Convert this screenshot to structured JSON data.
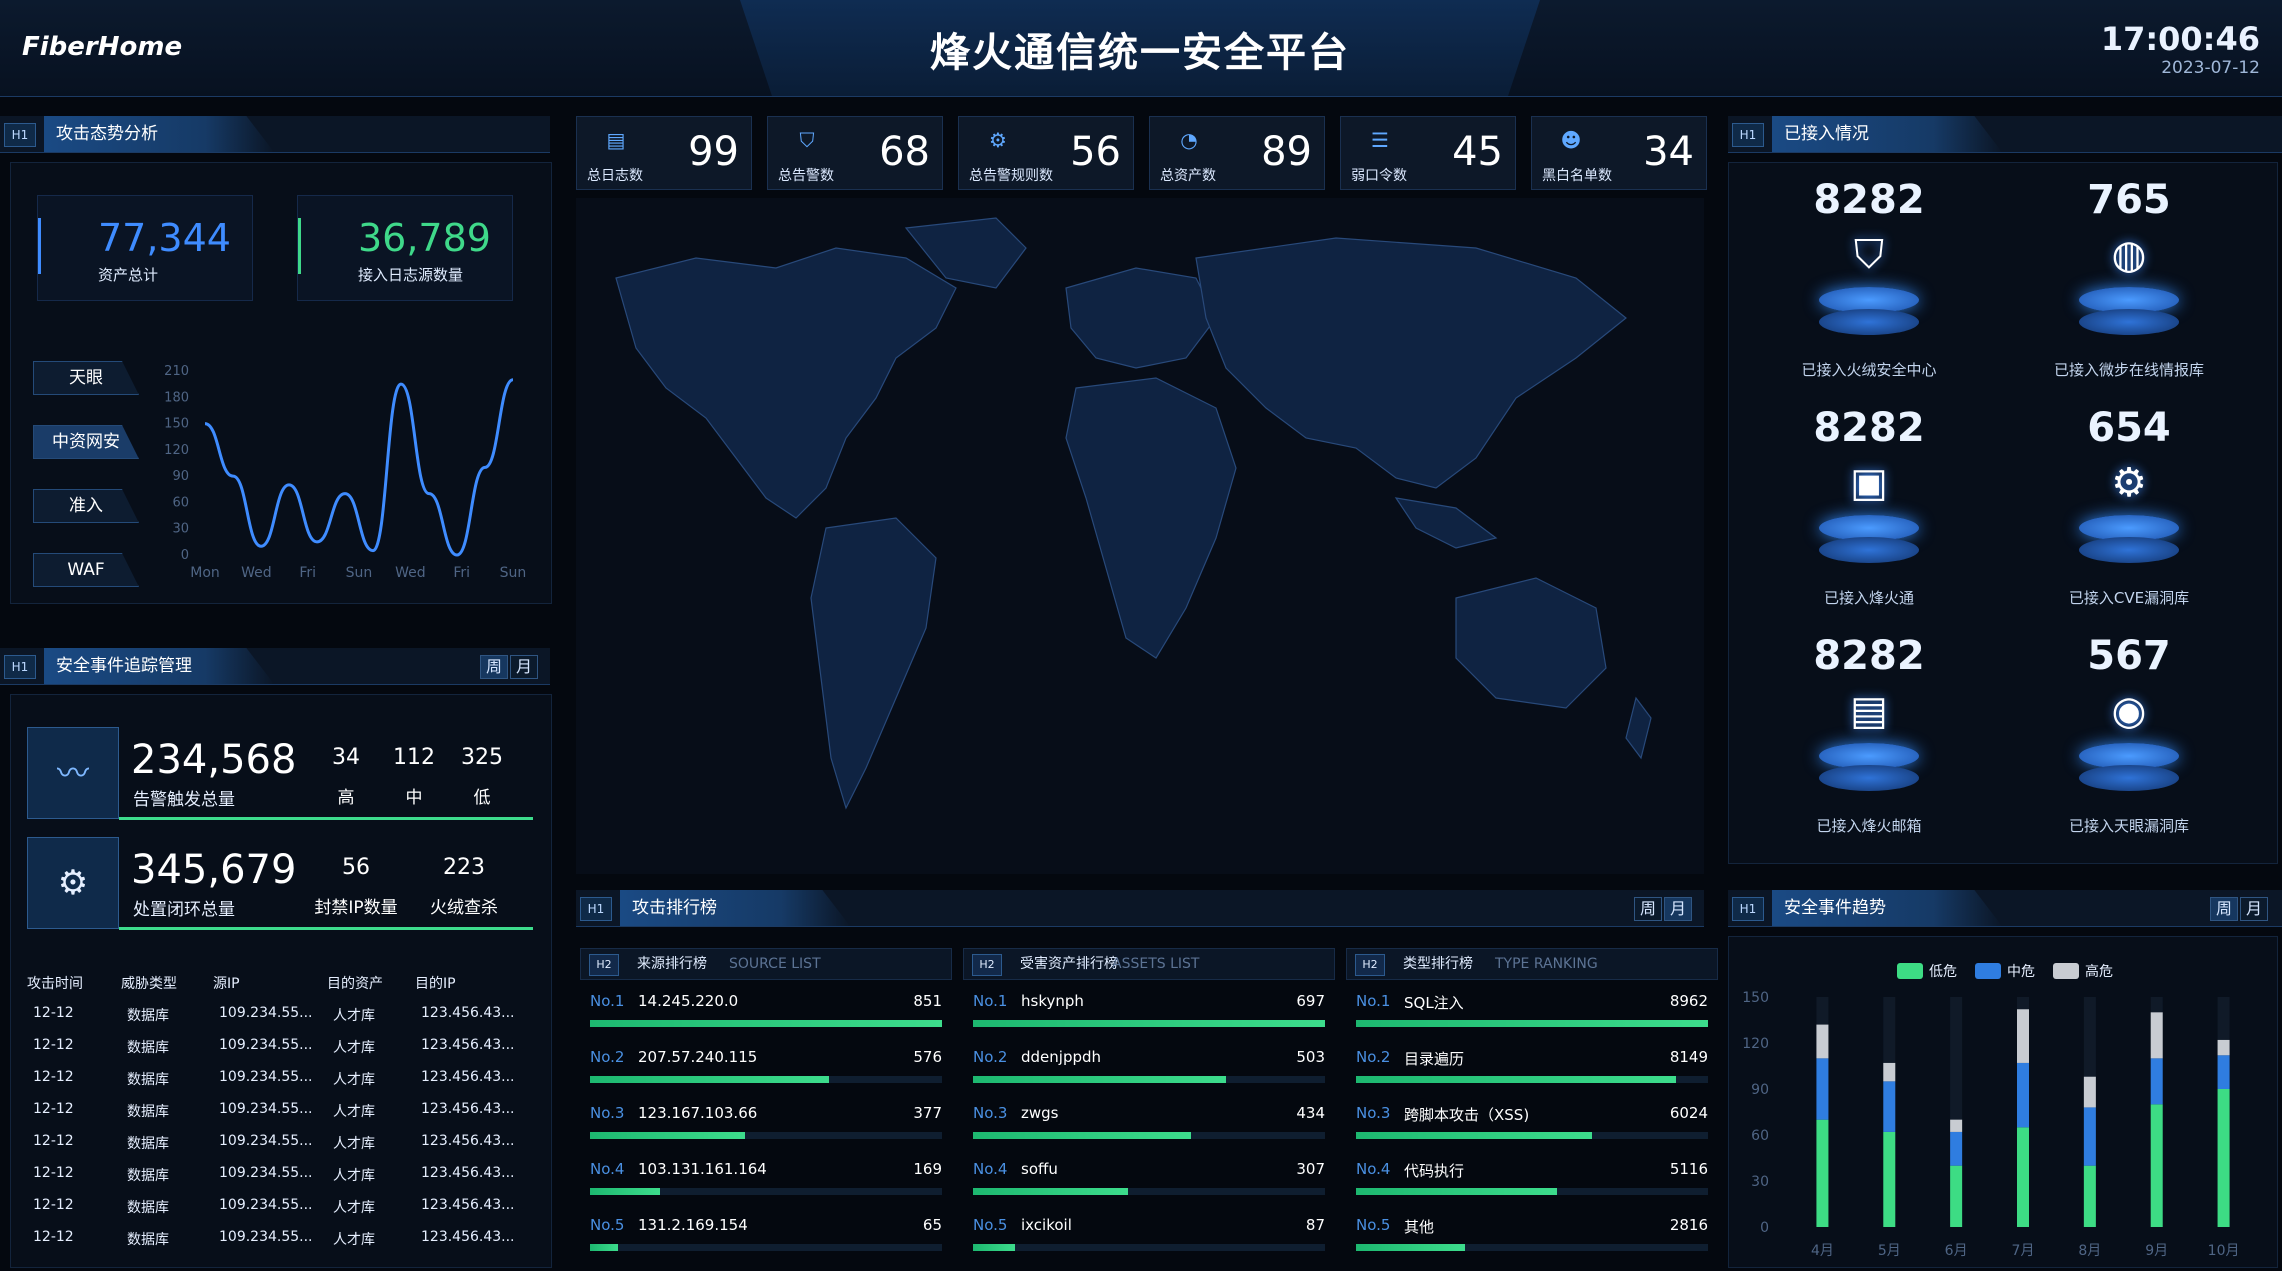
{
  "header": {
    "logo": "FiberHome",
    "title": "烽火通信统一安全平台",
    "time": "17:00:46",
    "date": "2023-07-12"
  },
  "attack_panel": {
    "tag": "H1",
    "title": "攻击态势分析",
    "kpi1": {
      "value": "77,344",
      "label": "资产总计",
      "color": "#3f8cff"
    },
    "kpi2": {
      "value": "36,789",
      "label": "接入日志源数量",
      "color": "#3fd98a"
    },
    "tabs": [
      "天眼",
      "中资网安",
      "准入",
      "WAF"
    ],
    "chart_data": {
      "type": "line",
      "x": [
        "Mon",
        "Wed",
        "Fri",
        "Sun",
        "Wed",
        "Fri",
        "Sun"
      ],
      "y_ticks": [
        "210",
        "180",
        "150",
        "120",
        "90",
        "60",
        "30",
        "0"
      ],
      "ylim": [
        0,
        210
      ],
      "values": [
        150,
        90,
        10,
        80,
        15,
        70,
        5,
        195,
        70,
        0,
        100,
        200
      ]
    }
  },
  "stats": [
    {
      "icon": "log-icon",
      "label": "总日志数",
      "value": "99"
    },
    {
      "icon": "shield-icon",
      "label": "总告警数",
      "value": "68"
    },
    {
      "icon": "rules-icon",
      "label": "总告警规则数",
      "value": "56"
    },
    {
      "icon": "pie-icon",
      "label": "总资产数",
      "value": "89"
    },
    {
      "icon": "password-icon",
      "label": "弱口令数",
      "value": "45"
    },
    {
      "icon": "user-icon",
      "label": "黑白名单数",
      "value": "34"
    }
  ],
  "connected": {
    "tag": "H1",
    "title": "已接入情况",
    "items": [
      {
        "value": "8282",
        "label": "已接入火绒安全中心",
        "icon": "shield-icon"
      },
      {
        "value": "765",
        "label": "已接入微步在线情报库",
        "icon": "globe-icon"
      },
      {
        "value": "8282",
        "label": "已接入烽火通",
        "icon": "cube-icon"
      },
      {
        "value": "654",
        "label": "已接入CVE漏洞库",
        "icon": "gear-icon"
      },
      {
        "value": "8282",
        "label": "已接入烽火邮箱",
        "icon": "mail-icon"
      },
      {
        "value": "567",
        "label": "已接入天眼漏洞库",
        "icon": "eye-icon"
      }
    ]
  },
  "events": {
    "tag": "H1",
    "title": "安全事件追踪管理",
    "week": "周",
    "month": "月",
    "alert_total": "234,568",
    "alert_label": "告警触发总量",
    "alert_breakdown": [
      {
        "v": "34",
        "l": "高"
      },
      {
        "v": "112",
        "l": "中"
      },
      {
        "v": "325",
        "l": "低"
      }
    ],
    "handled_total": "345,679",
    "handled_label": "处置闭环总量",
    "handled_breakdown": [
      {
        "v": "56",
        "l": "封禁IP数量"
      },
      {
        "v": "223",
        "l": "火绒查杀"
      }
    ],
    "columns": [
      "攻击时间",
      "威胁类型",
      "源IP",
      "目的资产",
      "目的IP"
    ],
    "rows": [
      [
        "12-12",
        "数据库",
        "109.234.55...",
        "人才库",
        "123.456.43..."
      ],
      [
        "12-12",
        "数据库",
        "109.234.55...",
        "人才库",
        "123.456.43..."
      ],
      [
        "12-12",
        "数据库",
        "109.234.55...",
        "人才库",
        "123.456.43..."
      ],
      [
        "12-12",
        "数据库",
        "109.234.55...",
        "人才库",
        "123.456.43..."
      ],
      [
        "12-12",
        "数据库",
        "109.234.55...",
        "人才库",
        "123.456.43..."
      ],
      [
        "12-12",
        "数据库",
        "109.234.55...",
        "人才库",
        "123.456.43..."
      ],
      [
        "12-12",
        "数据库",
        "109.234.55...",
        "人才库",
        "123.456.43..."
      ],
      [
        "12-12",
        "数据库",
        "109.234.55...",
        "人才库",
        "123.456.43..."
      ]
    ]
  },
  "ranking": {
    "tag": "H1",
    "title": "攻击排行榜",
    "week": "周",
    "month": "月",
    "cols": [
      {
        "tag": "H2",
        "title": "来源排行榜",
        "sub": "SOURCE LIST",
        "items": [
          {
            "no": "No.1",
            "name": "14.245.220.0",
            "value": "851",
            "pct": 100
          },
          {
            "no": "No.2",
            "name": "207.57.240.115",
            "value": "576",
            "pct": 68
          },
          {
            "no": "No.3",
            "name": "123.167.103.66",
            "value": "377",
            "pct": 44
          },
          {
            "no": "No.4",
            "name": "103.131.161.164",
            "value": "169",
            "pct": 20
          },
          {
            "no": "No.5",
            "name": "131.2.169.154",
            "value": "65",
            "pct": 8
          }
        ]
      },
      {
        "tag": "H2",
        "title": "受害资产排行榜",
        "sub": "ASSETS LIST",
        "items": [
          {
            "no": "No.1",
            "name": "hskynph",
            "value": "697",
            "pct": 100
          },
          {
            "no": "No.2",
            "name": "ddenjppdh",
            "value": "503",
            "pct": 72
          },
          {
            "no": "No.3",
            "name": "zwgs",
            "value": "434",
            "pct": 62
          },
          {
            "no": "No.4",
            "name": "soffu",
            "value": "307",
            "pct": 44
          },
          {
            "no": "No.5",
            "name": "ixcikoil",
            "value": "87",
            "pct": 12
          }
        ]
      },
      {
        "tag": "H2",
        "title": "类型排行榜",
        "sub": "TYPE RANKING",
        "items": [
          {
            "no": "No.1",
            "name": "SQL注入",
            "value": "8962",
            "pct": 100
          },
          {
            "no": "No.2",
            "name": "目录遍历",
            "value": "8149",
            "pct": 91
          },
          {
            "no": "No.3",
            "name": "跨脚本攻击（XSS)",
            "value": "6024",
            "pct": 67
          },
          {
            "no": "No.4",
            "name": "代码执行",
            "value": "5116",
            "pct": 57
          },
          {
            "no": "No.5",
            "name": "其他",
            "value": "2816",
            "pct": 31
          }
        ]
      }
    ]
  },
  "trend": {
    "tag": "H1",
    "title": "安全事件趋势",
    "week": "周",
    "month": "月",
    "chart_data": {
      "type": "bar",
      "stacked": true,
      "categories": [
        "4月",
        "5月",
        "6月",
        "7月",
        "8月",
        "9月",
        "10月"
      ],
      "y_ticks": [
        "150",
        "120",
        "90",
        "60",
        "30",
        "0"
      ],
      "ylim": [
        0,
        150
      ],
      "series": [
        {
          "name": "低危",
          "color": "#3ddc84",
          "values": [
            70,
            62,
            40,
            65,
            40,
            80,
            90
          ]
        },
        {
          "name": "中危",
          "color": "#2f7de0",
          "values": [
            40,
            33,
            22,
            42,
            38,
            30,
            22
          ]
        },
        {
          "name": "高危",
          "color": "#c8ccd2",
          "values": [
            22,
            12,
            8,
            35,
            20,
            30,
            10
          ]
        }
      ]
    }
  }
}
